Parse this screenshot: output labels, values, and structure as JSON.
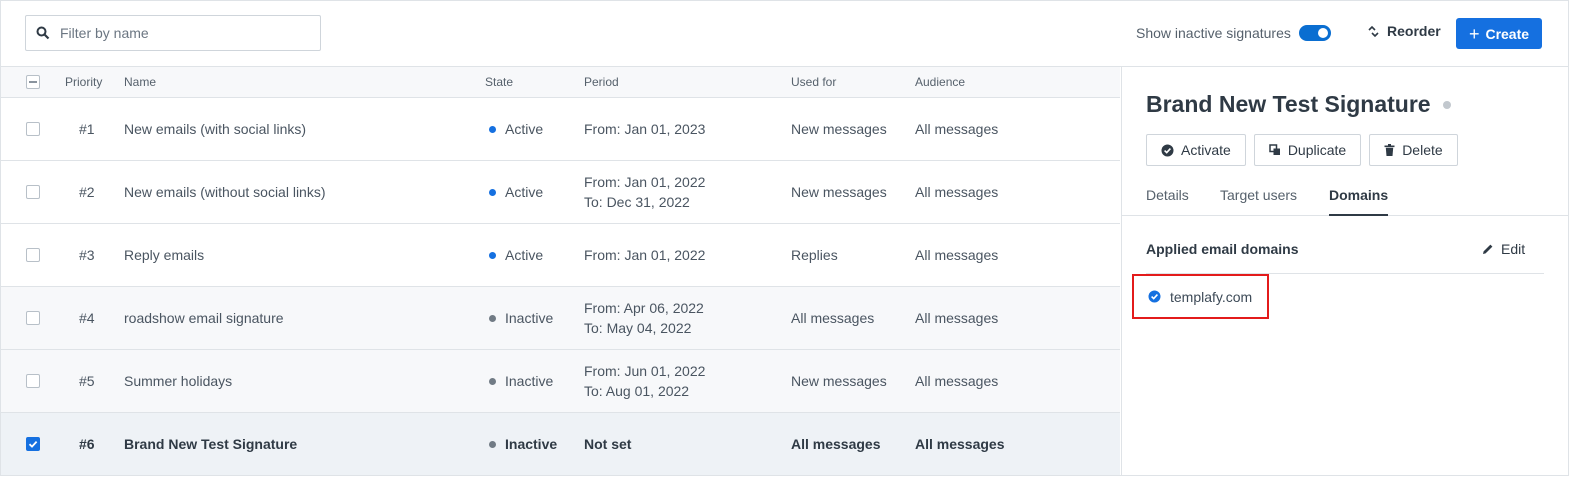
{
  "toolbar": {
    "search_placeholder": "Filter by name",
    "show_inactive_label": "Show inactive signatures",
    "show_inactive_on": true,
    "reorder_label": "Reorder",
    "create_label": "Create"
  },
  "table": {
    "headers": {
      "priority": "Priority",
      "name": "Name",
      "state": "State",
      "period": "Period",
      "used_for": "Used for",
      "audience": "Audience"
    },
    "rows": [
      {
        "priority": "#1",
        "name": "New emails (with social links)",
        "state": "Active",
        "period_from": "From: Jan 01, 2023",
        "period_to": "",
        "used_for": "New messages",
        "audience": "All messages"
      },
      {
        "priority": "#2",
        "name": "New emails (without social links)",
        "state": "Active",
        "period_from": "From: Jan 01, 2022",
        "period_to": "To: Dec 31, 2022",
        "used_for": "New messages",
        "audience": "All messages"
      },
      {
        "priority": "#3",
        "name": "Reply emails",
        "state": "Active",
        "period_from": "From: Jan 01, 2022",
        "period_to": "",
        "used_for": "Replies",
        "audience": "All messages"
      },
      {
        "priority": "#4",
        "name": "roadshow email signature",
        "state": "Inactive",
        "period_from": "From: Apr 06, 2022",
        "period_to": "To: May 04, 2022",
        "used_for": "All messages",
        "audience": "All messages"
      },
      {
        "priority": "#5",
        "name": "Summer holidays",
        "state": "Inactive",
        "period_from": "From: Jun 01, 2022",
        "period_to": "To: Aug 01, 2022",
        "used_for": "New messages",
        "audience": "All messages"
      },
      {
        "priority": "#6",
        "name": "Brand New Test Signature",
        "state": "Inactive",
        "period_from": "Not set",
        "period_to": "",
        "used_for": "All messages",
        "audience": "All messages"
      }
    ]
  },
  "panel": {
    "title": "Brand New Test Signature",
    "buttons": {
      "activate": "Activate",
      "duplicate": "Duplicate",
      "delete": "Delete"
    },
    "tabs": {
      "details": "Details",
      "target_users": "Target users",
      "domains": "Domains"
    },
    "active_tab": "Domains",
    "section_title": "Applied email domains",
    "edit_label": "Edit",
    "domains": [
      "templafy.com"
    ]
  },
  "colors": {
    "accent": "#1570e0",
    "highlight": "#e31b1b",
    "inactive_dot": "#717b85"
  }
}
